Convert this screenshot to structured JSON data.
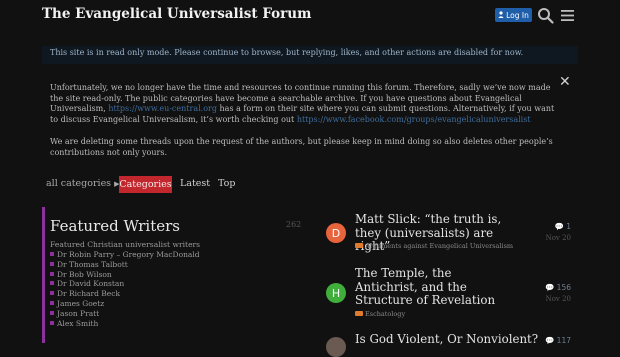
{
  "header": {
    "title": "The Evangelical Universalist Forum",
    "login_label": "Log In",
    "search_icon": "search-icon",
    "menu_icon": "hamburger-icon"
  },
  "readonly_banner": {
    "text": "This site is in read only mode. Please continue to browse, but replying, likes, and other actions are disabled for now."
  },
  "notice": {
    "p1_a": "Unfortunately, we no longer have the time and resources to continue running this forum. Therefore, sadly we’ve now made the site read-only. The public categories have become a searchable archive. If you have questions about Evangelical Universalism, ",
    "p1_link1": "https://www.eu-central.org",
    "p1_b": " has a form on their site where you can submit questions. Alternatively, if you want to discuss Evangelical Universalism, it’s worth checking out ",
    "p1_link2": "https://www.facebook.com/groups/evangelicaluniversalist",
    "p2": "We are deleting some threads upon the request of the authors, but please keep in mind doing so also deletes other people’s contributions not only yours."
  },
  "nav": {
    "dropdown_label": "all categories",
    "tabs": [
      "Categories",
      "Latest",
      "Top"
    ]
  },
  "category": {
    "name": "Featured Writers",
    "count": "262",
    "description": "Featured Christian universalist writers",
    "subcategories": [
      "Dr Robin Parry – Gregory MacDonald",
      "Dr Thomas Talbott",
      "Dr Bob Wilson",
      "Dr David Konstan",
      "Dr Richard Beck",
      "James Goetz",
      "Jason Pratt",
      "Alex Smith"
    ]
  },
  "topics": [
    {
      "avatar": "D",
      "avatar_color": "#e8643c",
      "title": "Matt Slick: “the truth is, they (universalists) are right”",
      "category": "Arguments against Evangelical Universalism",
      "replies": "1",
      "date": "Nov 20"
    },
    {
      "avatar": "H",
      "avatar_color": "#3fae3b",
      "title": "The Temple, the Antichrist, and the Structure of Revelation",
      "category": "Eschatology",
      "replies": "156",
      "date": "Nov 20"
    },
    {
      "avatar": "",
      "avatar_color": "#6b5a52",
      "title": "Is God Violent, Or Nonviolent?",
      "category": "",
      "replies": "117",
      "date": ""
    }
  ],
  "colors": {
    "accent": "#c1272d",
    "category_color": "#8d2f9c",
    "login_button": "#1f5ea8"
  }
}
